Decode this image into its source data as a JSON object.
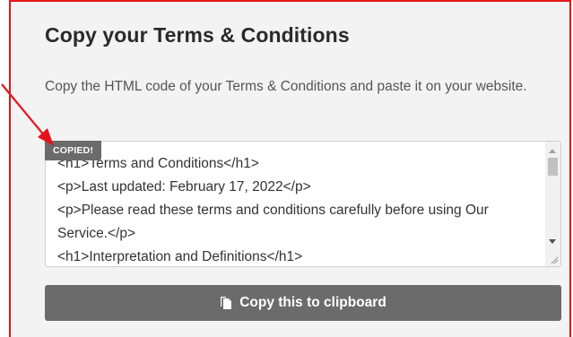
{
  "section": {
    "title": "Copy your Terms & Conditions",
    "description": "Copy the HTML code of your Terms & Conditions and paste it on your website."
  },
  "code_box": {
    "badge": "COPIED!",
    "content": "<h1>Terms and Conditions</h1>\n<p>Last updated: February 17, 2022</p>\n<p>Please read these terms and conditions carefully before using Our Service.</p>\n<h1>Interpretation and Definitions</h1>"
  },
  "copy_button": {
    "label": "Copy this to clipboard",
    "icon": "copy-document-icon"
  },
  "colors": {
    "annotation": "#e3151a",
    "panel_background": "#f3f3f3",
    "button_background": "#6b6b6b",
    "title_text": "#2a2a2a"
  }
}
